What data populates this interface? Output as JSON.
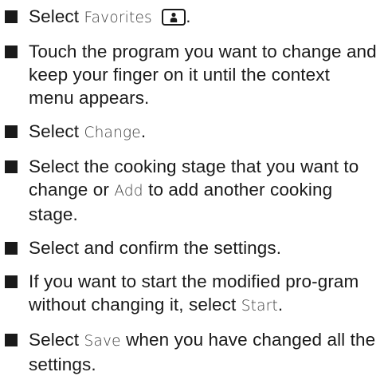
{
  "steps": [
    {
      "prefix": "Select ",
      "ui_term": "Favorites",
      "icon": "favorites-icon",
      "suffix": "."
    },
    {
      "text": "Touch the program you want to change and keep your finger on it until the context menu appears."
    },
    {
      "prefix": "Select ",
      "ui_term": "Change",
      "suffix": "."
    },
    {
      "prefix": "Select the cooking stage that you want to change or ",
      "ui_term": "Add",
      "suffix": " to add another cooking stage."
    },
    {
      "text": "Select and confirm the settings."
    },
    {
      "prefix": "If you want to start the modified pro-gram without changing it, select ",
      "ui_term": "Start",
      "suffix": "."
    },
    {
      "prefix": "Select ",
      "ui_term": "Save",
      "suffix": " when you have changed all the settings."
    }
  ]
}
